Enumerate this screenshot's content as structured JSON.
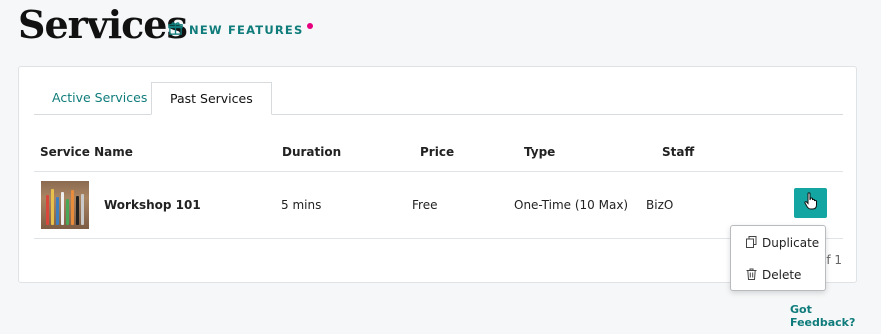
{
  "header": {
    "title": "Services",
    "new_features_label": "NEW FEATURES"
  },
  "tabs": [
    {
      "label": "Active Services",
      "active": false
    },
    {
      "label": "Past Services",
      "active": true
    }
  ],
  "table": {
    "columns": [
      "Service Name",
      "Duration",
      "Price",
      "Type",
      "Staff"
    ],
    "rows": [
      {
        "name": "Workshop 101",
        "duration": "5 mins",
        "price": "Free",
        "type": "One-Time (10 Max)",
        "staff": "BizO"
      }
    ]
  },
  "pagination": {
    "text": "of 1"
  },
  "context_menu": {
    "items": [
      {
        "label": "Duplicate",
        "icon": "duplicate-icon"
      },
      {
        "label": "Delete",
        "icon": "trash-icon"
      }
    ]
  },
  "footer": {
    "feedback_link": "Got Feedback?"
  },
  "colors": {
    "accent": "#0f7c7b",
    "action_button": "#13a5a2",
    "notification_dot": "#e6007e"
  }
}
